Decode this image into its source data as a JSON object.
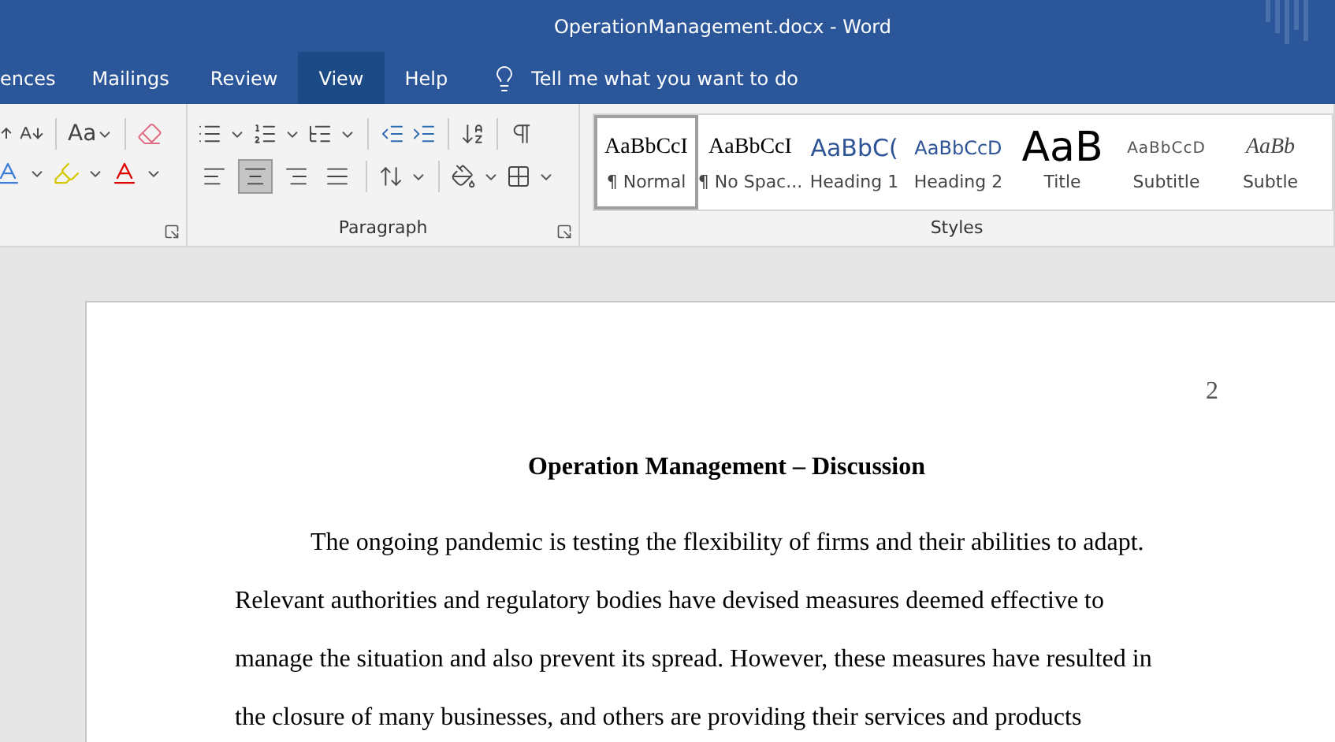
{
  "window": {
    "title": "OperationManagement.docx  -  Word"
  },
  "tabs": [
    {
      "label": "ences",
      "selected": false
    },
    {
      "label": "Mailings",
      "selected": false
    },
    {
      "label": "Review",
      "selected": false
    },
    {
      "label": "View",
      "selected": true
    },
    {
      "label": "Help",
      "selected": false
    }
  ],
  "tell_me": {
    "placeholder": "Tell me what you want to do"
  },
  "font_group": {
    "change_case": "Aa"
  },
  "paragraph_group": {
    "label": "Paragraph",
    "alignment": [
      {
        "kind": "left",
        "selected": false
      },
      {
        "kind": "center",
        "selected": true
      },
      {
        "kind": "right",
        "selected": false
      },
      {
        "kind": "justify",
        "selected": false
      }
    ]
  },
  "styles_group": {
    "label": "Styles",
    "styles": [
      {
        "kind": "normal",
        "preview": "AaBbCcI",
        "name": "¶ Normal",
        "selected": true
      },
      {
        "kind": "nospacing",
        "preview": "AaBbCcI",
        "name": "¶ No Spac...",
        "selected": false
      },
      {
        "kind": "heading1",
        "preview": "AaBbC(",
        "name": "Heading 1",
        "selected": false
      },
      {
        "kind": "heading2",
        "preview": "AaBbCcD",
        "name": "Heading 2",
        "selected": false
      },
      {
        "kind": "title",
        "preview": "AaB",
        "name": "Title",
        "selected": false
      },
      {
        "kind": "subtitle",
        "preview": "AaBbCcD",
        "name": "Subtitle",
        "selected": false
      },
      {
        "kind": "subtle",
        "preview": "AaBb",
        "name": "Subtle",
        "selected": false
      }
    ]
  },
  "document": {
    "page_number": "2",
    "heading": "Operation Management – Discussion",
    "paragraph": "The ongoing pandemic is testing the flexibility of firms and their abilities to adapt. Relevant authorities and regulatory bodies have devised measures deemed effective to manage the situation and also prevent its spread. However, these measures have resulted in the closure of many businesses, and others are providing their services and products"
  }
}
